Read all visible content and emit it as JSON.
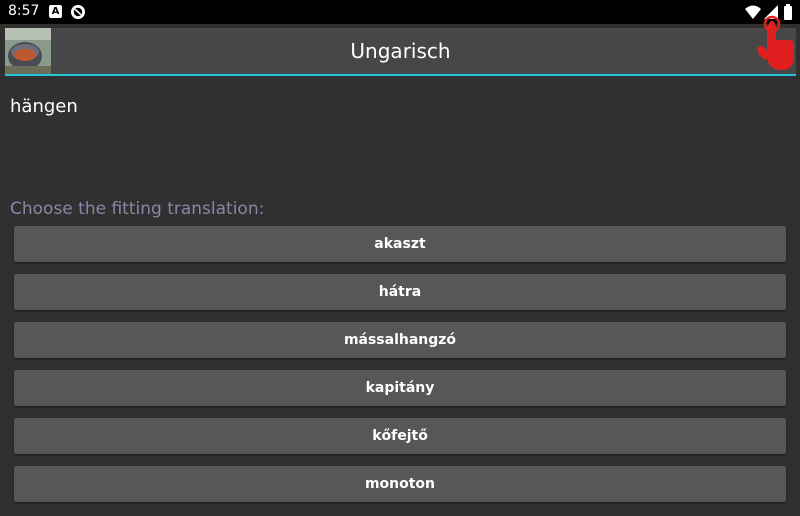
{
  "status_bar": {
    "time": "8:57",
    "notification_letter": "A"
  },
  "toolbar": {
    "title": "Ungarisch",
    "accent_color": "#27c3d8"
  },
  "quiz": {
    "word": "hängen",
    "prompt": "Choose the fitting translation:",
    "prompt_color": "#8a86a6",
    "options": [
      "akaszt",
      "hátra",
      "mássalhangzó",
      "kapitány",
      "kőfejtő",
      "monoton"
    ]
  }
}
